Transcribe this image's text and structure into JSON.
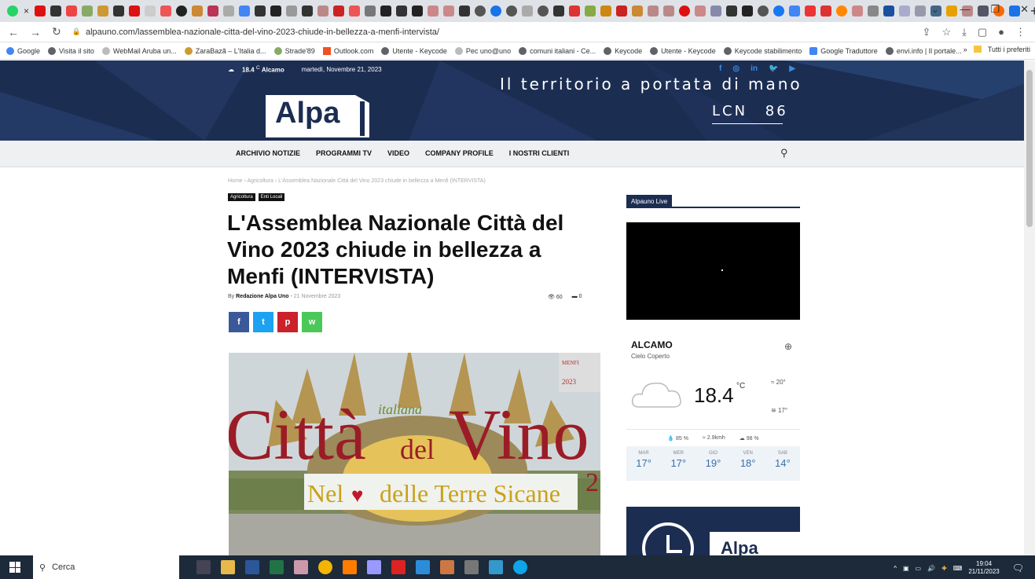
{
  "browser": {
    "tab_close": "×",
    "new_tab": "+",
    "window_controls": [
      "⌄",
      "—",
      "❐",
      "✕"
    ],
    "url": "alpauno.com/lassemblea-nazionale-citta-del-vino-2023-chiude-in-bellezza-a-menfi-intervista/",
    "bookmarks": [
      "Google",
      "Visita il sito",
      "WebMail Aruba un...",
      "ZaraBazã – L'Italia d...",
      "Strade'89",
      "Outlook.com",
      "Utente - Keycode",
      "Pec uno@uno",
      "comuni italiani - Ce...",
      "Keycode",
      "Utente - Keycode",
      "Keycode stabilimento",
      "Google Traduttore",
      "envi.info | Il portale..."
    ],
    "bookmarks_more": "»",
    "bookmarks_folder": "Tutti i preferiti"
  },
  "header": {
    "weather_temp": "18.4",
    "weather_unit": "C",
    "weather_city": "Alcamo",
    "date": "martedì, Novembre 21, 2023",
    "social": [
      "f",
      "◎",
      "in",
      "🐦",
      "▶"
    ],
    "tagline": "Il territorio a portata di mano",
    "lcn_label": "LCN",
    "lcn_value": "86",
    "logo_text": "Alpa"
  },
  "menu": {
    "items": [
      "ARCHIVIO NOTIZIE",
      "PROGRAMMI TV",
      "VIDEO",
      "COMPANY PROFILE",
      "I NOSTRI CLIENTI"
    ]
  },
  "article": {
    "breadcrumbs": "Home › Agricoltura › L'Assemblea Nazionale Città del Vino 2023 chiude in bellezza a Menfi (INTERVISTA)",
    "categories": [
      "Agricoltura",
      "Enti Locali"
    ],
    "title": "L'Assemblea Nazionale Città del Vino 2023 chiude in bellezza a Menfi (INTERVISTA)",
    "by": "By",
    "author": "Redazione Alpa Uno",
    "date": "21 Novembre 2023",
    "views": "60",
    "comments": "0",
    "share_buttons": [
      "f",
      "t",
      "p",
      "w"
    ],
    "image_texts": {
      "word1": "Città",
      "word2": "del",
      "word3": "Vino",
      "script": "italiana",
      "banner": "delle Terre Sicane",
      "banner_prefix": "Nel",
      "corner": "2",
      "sign_top": "MENFI",
      "sign_year": "2023"
    }
  },
  "sidebar": {
    "live_title": "Alpauno Live",
    "weather": {
      "city": "ALCAMO",
      "description": "Cielo Coperto",
      "temp": "18.4",
      "unit": "°C",
      "high": "20°",
      "low": "17°",
      "humidity": "85 %",
      "wind": "2.9kmh",
      "clouds": "98 %",
      "forecast": [
        {
          "day": "MAR",
          "temp": "17°"
        },
        {
          "day": "MER",
          "temp": "17°"
        },
        {
          "day": "GIO",
          "temp": "19°"
        },
        {
          "day": "VEN",
          "temp": "18°"
        },
        {
          "day": "SAB",
          "temp": "14°"
        }
      ]
    },
    "promo_logo": "Alpa"
  },
  "taskbar": {
    "search_placeholder": "Cerca",
    "time": "19:04",
    "date": "21/11/2023"
  },
  "colors": {
    "brand_navy": "#1c2d52",
    "facebook": "#3b5998",
    "twitter": "#1da1f2",
    "pinterest": "#ca212a",
    "whatsapp": "#4ac959"
  }
}
